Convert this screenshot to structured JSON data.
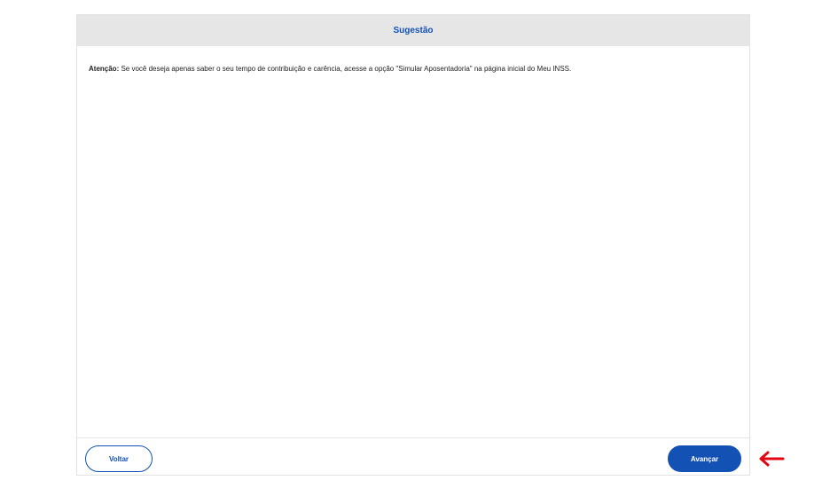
{
  "header": {
    "title": "Sugestão"
  },
  "body": {
    "notice_label": "Atenção:",
    "notice_text": " Se você deseja apenas saber o seu tempo de contribuição e carência, acesse a opção \"Simular Aposentadoria\" na página inicial do Meu INSS."
  },
  "footer": {
    "back_label": "Voltar",
    "next_label": "Avançar"
  },
  "colors": {
    "accent": "#1351b4",
    "header_bg": "#e6e6e6",
    "annotation": "#e30613"
  },
  "annotation": {
    "icon": "arrow-left-icon"
  }
}
